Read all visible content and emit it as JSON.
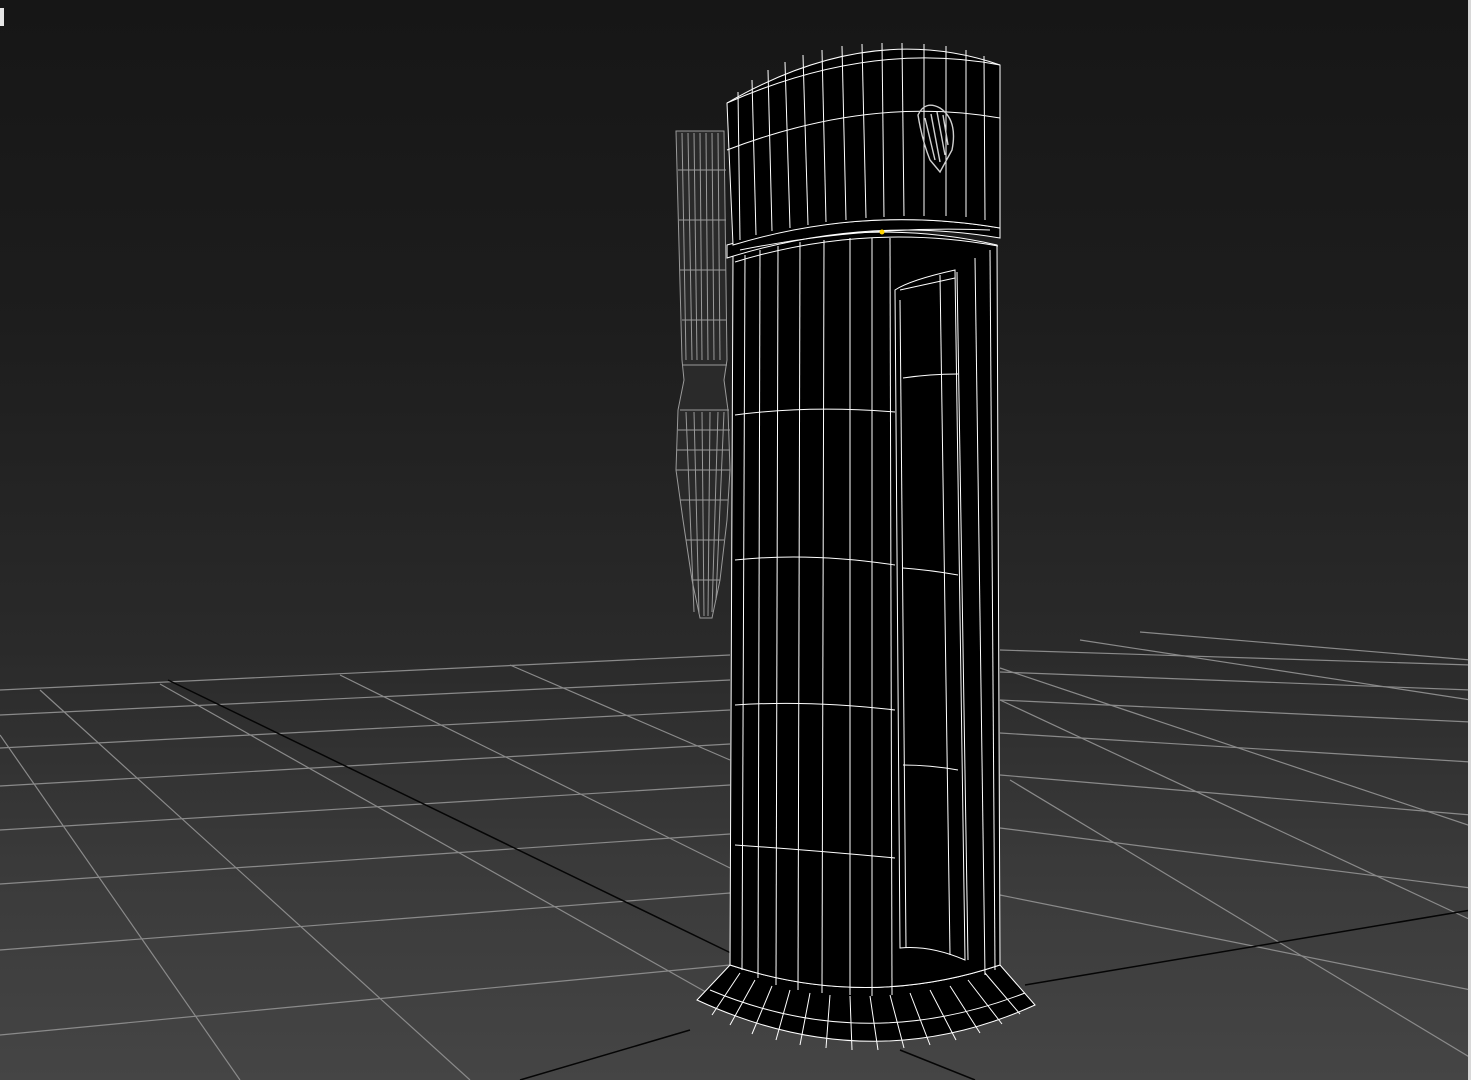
{
  "viewport": {
    "background_top": "#161616",
    "background_bottom": "#454545",
    "grid_color": "#8a8a8a",
    "axis_color": "#050505",
    "wire_color": "#ffffff",
    "helper_wire_color": "#9a9a9a",
    "vertex_highlight_color": "#ffd400"
  },
  "scene": {
    "objects": [
      {
        "name": "beer-tap-tower",
        "type": "cylinder-wireframe"
      },
      {
        "name": "tap-handle",
        "type": "handle-wireframe"
      },
      {
        "name": "harp-logo",
        "type": "emblem"
      },
      {
        "name": "ground-grid",
        "type": "grid"
      }
    ]
  }
}
